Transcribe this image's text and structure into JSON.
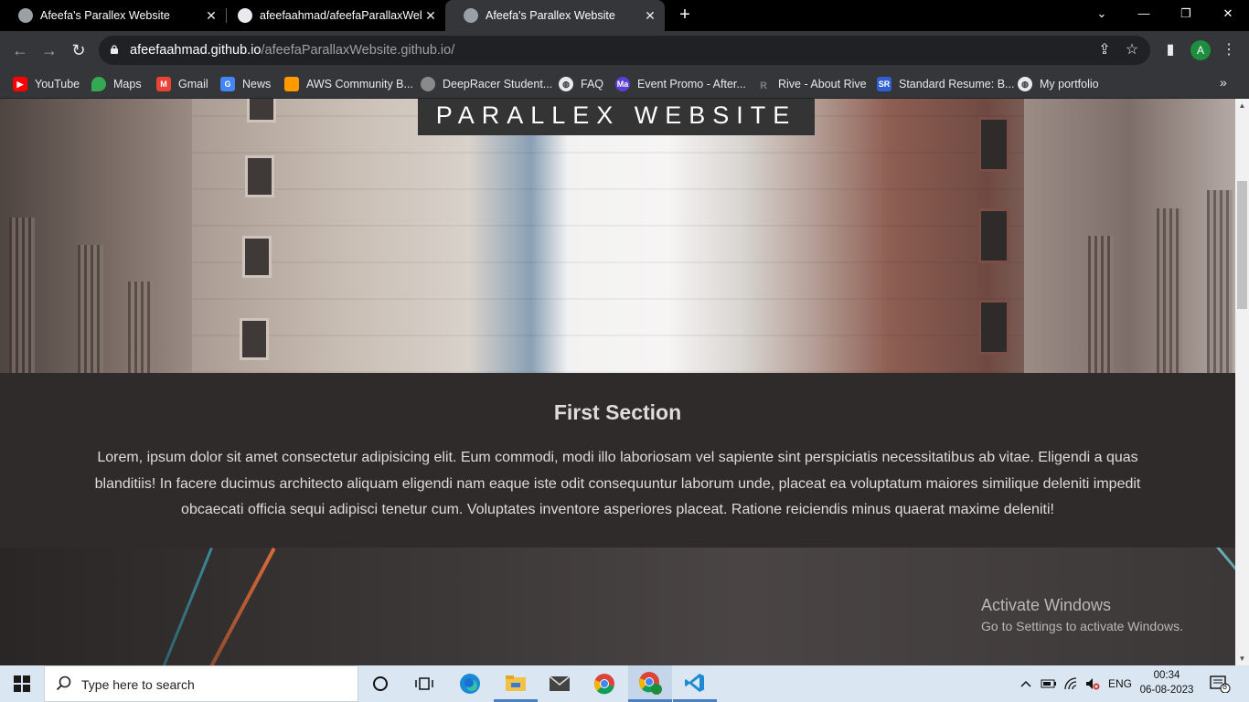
{
  "browser": {
    "tabs": [
      {
        "title": "Afeefa's Parallex Website",
        "active": false
      },
      {
        "title": "afeefaahmad/afeefaParallaxWebsite",
        "active": false
      },
      {
        "title": "Afeefa's Parallex Website",
        "active": true
      }
    ],
    "url_host": "afeefaahmad.github.io",
    "url_path": "/afeefaParallaxWebsite.github.io/",
    "profile_initial": "A",
    "bookmarks": [
      {
        "label": "YouTube",
        "icon": "youtube-icon",
        "color": "#ff0000"
      },
      {
        "label": "Maps",
        "icon": "maps-icon",
        "color": "#34a853"
      },
      {
        "label": "Gmail",
        "icon": "gmail-icon",
        "color": "#ea4335"
      },
      {
        "label": "News",
        "icon": "news-icon",
        "color": "#4285f4"
      },
      {
        "label": "AWS Community B...",
        "icon": "aws-icon",
        "color": "#ff9900"
      },
      {
        "label": "DeepRacer Student...",
        "icon": "deepracer-icon",
        "color": "#8a8a8a"
      },
      {
        "label": "FAQ",
        "icon": "globe-icon",
        "color": "#e8eaed"
      },
      {
        "label": "Event Promo - After...",
        "icon": "event-icon",
        "color": "#5b3fd6"
      },
      {
        "label": "Rive - About Rive",
        "icon": "rive-icon",
        "color": "#777777"
      },
      {
        "label": "Standard Resume: B...",
        "icon": "resume-icon",
        "color": "#2f5fd0"
      },
      {
        "label": "My portfolio",
        "icon": "globe-icon",
        "color": "#e8eaed"
      }
    ]
  },
  "page": {
    "hero_title": "PARALLEX WEBSITE",
    "section_title": "First Section",
    "section_text": "Lorem, ipsum dolor sit amet consectetur adipisicing elit. Eum commodi, modi illo laboriosam vel sapiente sint perspiciatis necessitatibus ab vitae. Eligendi a quas blanditiis! In facere ducimus architecto aliquam eligendi nam eaque iste odit consequuntur laborum unde, placeat ea voluptatum maiores similique deleniti impedit obcaecati officia sequi adipisci tenetur cum. Voluptates inventore asperiores placeat. Ratione reiciendis minus quaerat maxime deleniti!"
  },
  "watermark": {
    "line1": "Activate Windows",
    "line2": "Go to Settings to activate Windows."
  },
  "taskbar": {
    "search_placeholder": "Type here to search",
    "language": "ENG",
    "time": "00:34",
    "date": "06-08-2023",
    "notification_count": "8"
  }
}
